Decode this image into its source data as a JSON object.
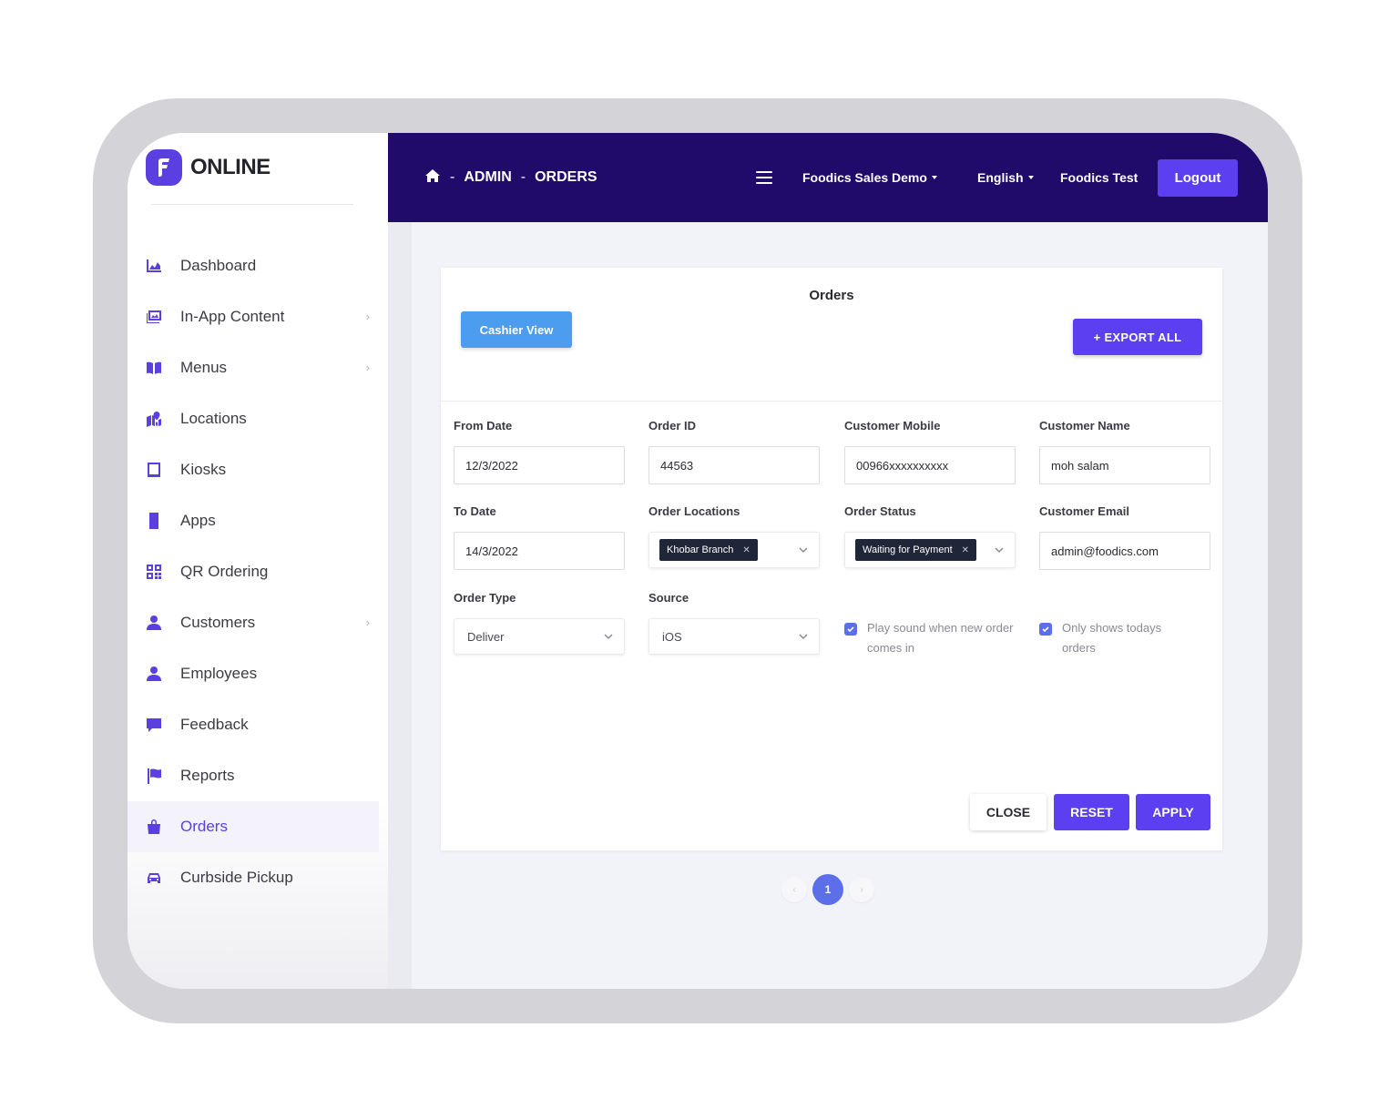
{
  "app": {
    "logo_text": "ONLINE",
    "accent_color": "#5b3fe0",
    "topbar_color": "#200a6a"
  },
  "sidebar": {
    "items": [
      {
        "label": "Dashboard",
        "icon": "chart-area-icon",
        "has_submenu": false,
        "active": false
      },
      {
        "label": "In-App Content",
        "icon": "images-icon",
        "has_submenu": true,
        "active": false
      },
      {
        "label": "Menus",
        "icon": "book-open-icon",
        "has_submenu": true,
        "active": false
      },
      {
        "label": "Locations",
        "icon": "map-marked-icon",
        "has_submenu": false,
        "active": false
      },
      {
        "label": "Kiosks",
        "icon": "tablet-icon",
        "has_submenu": false,
        "active": false
      },
      {
        "label": "Apps",
        "icon": "mobile-icon",
        "has_submenu": false,
        "active": false
      },
      {
        "label": "QR Ordering",
        "icon": "qrcode-icon",
        "has_submenu": false,
        "active": false
      },
      {
        "label": "Customers",
        "icon": "user-icon",
        "has_submenu": true,
        "active": false
      },
      {
        "label": "Employees",
        "icon": "user-icon",
        "has_submenu": false,
        "active": false
      },
      {
        "label": "Feedback",
        "icon": "comment-icon",
        "has_submenu": false,
        "active": false
      },
      {
        "label": "Reports",
        "icon": "flag-icon",
        "has_submenu": false,
        "active": false
      },
      {
        "label": "Orders",
        "icon": "shopping-bag-icon",
        "has_submenu": false,
        "active": true
      },
      {
        "label": "Curbside Pickup",
        "icon": "car-icon",
        "has_submenu": false,
        "active": false
      }
    ]
  },
  "topbar": {
    "breadcrumb": [
      "ADMIN",
      "ORDERS"
    ],
    "breadcrumb_separator": "-",
    "business_menu": "Foodics Sales Demo",
    "language_menu": "English",
    "user_name": "Foodics Test",
    "logout_label": "Logout"
  },
  "orders_panel": {
    "title": "Orders",
    "cashier_view_label": "Cashier View",
    "export_all_label": "+ EXPORT ALL",
    "filters": {
      "from_date": {
        "label": "From Date",
        "value": "12/3/2022"
      },
      "order_id": {
        "label": "Order ID",
        "value": "44563"
      },
      "customer_mobile": {
        "label": "Customer Mobile",
        "value": "00966xxxxxxxxxx"
      },
      "customer_name": {
        "label": "Customer Name",
        "value": "moh salam"
      },
      "to_date": {
        "label": "To Date",
        "value": "14/3/2022"
      },
      "order_locations": {
        "label": "Order Locations",
        "selected": "Khobar Branch"
      },
      "order_status": {
        "label": "Order Status",
        "selected": "Waiting for Payment"
      },
      "customer_email": {
        "label": "Customer Email",
        "value": "admin@foodics.com"
      },
      "order_type": {
        "label": "Order Type",
        "value": "Deliver"
      },
      "source": {
        "label": "Source",
        "value": "iOS"
      }
    },
    "options": {
      "play_sound": {
        "label": "Play sound when new order comes in",
        "checked": true
      },
      "todays_only": {
        "label": "Only shows todays orders",
        "checked": true
      }
    },
    "close_label": "CLOSE",
    "reset_label": "RESET",
    "apply_label": "APPLY"
  },
  "pagination": {
    "prev": "‹",
    "current_page": "1",
    "next": "›"
  }
}
